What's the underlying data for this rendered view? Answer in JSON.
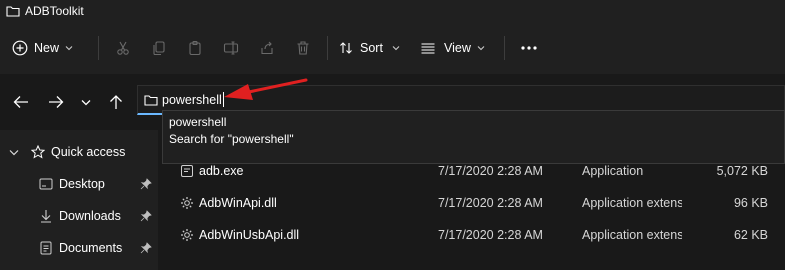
{
  "window": {
    "title": "ADBToolkit"
  },
  "toolbar": {
    "new_label": "New",
    "sort_label": "Sort",
    "view_label": "View",
    "icons": [
      "new-plus-icon",
      "cut-icon",
      "copy-icon",
      "paste-icon",
      "rename-icon",
      "share-icon",
      "delete-icon",
      "sort-icon",
      "view-icon",
      "more-icon"
    ]
  },
  "address_bar": {
    "value": "powershell"
  },
  "suggestions": [
    {
      "label": "powershell"
    },
    {
      "label": "Search for \"powershell\""
    }
  ],
  "sidebar": {
    "items": [
      {
        "label": "Quick access",
        "icon": "star-icon"
      },
      {
        "label": "Desktop",
        "icon": "desktop-icon",
        "pinned": true
      },
      {
        "label": "Downloads",
        "icon": "download-icon",
        "pinned": true
      },
      {
        "label": "Documents",
        "icon": "document-icon",
        "pinned": true
      }
    ]
  },
  "files": [
    {
      "name": "adb.exe",
      "date": "7/17/2020 2:28 AM",
      "type": "Application",
      "size": "5,072 KB",
      "icon": "exe-icon"
    },
    {
      "name": "AdbWinApi.dll",
      "date": "7/17/2020 2:28 AM",
      "type": "Application extension",
      "size": "96 KB",
      "icon": "dll-gear-icon"
    },
    {
      "name": "AdbWinUsbApi.dll",
      "date": "7/17/2020 2:28 AM",
      "type": "Application extension",
      "size": "62 KB",
      "icon": "dll-gear-icon"
    }
  ],
  "colors": {
    "background": "#191919",
    "panel": "#202020",
    "accent": "#6bb8ff",
    "folder": "#e8c56a",
    "arrow": "#e02020"
  }
}
